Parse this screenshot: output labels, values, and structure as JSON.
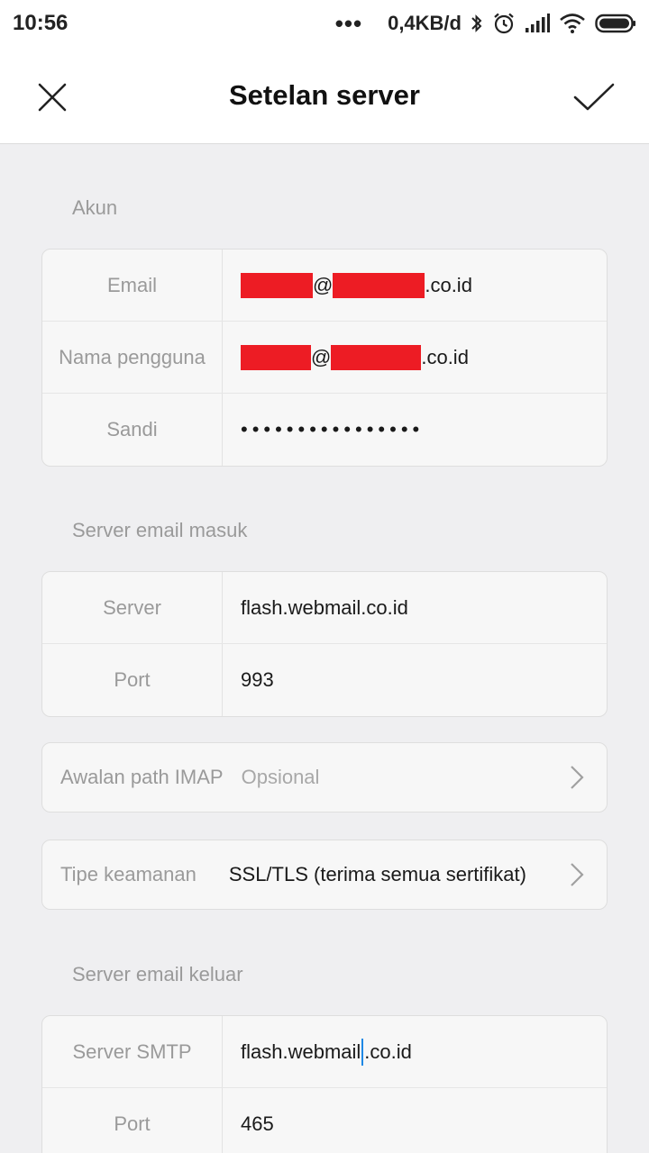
{
  "status_bar": {
    "time": "10:56",
    "dots": "•••",
    "network_speed": "0,4KB/d"
  },
  "app_bar": {
    "title": "Setelan server"
  },
  "account_section": {
    "heading": "Akun",
    "email_label": "Email",
    "email_suffix": ".co.id",
    "at_sign": "@",
    "username_label": "Nama pengguna",
    "username_suffix": ".co.id",
    "password_label": "Sandi",
    "password_mask": "••••••••••••••••"
  },
  "incoming_section": {
    "heading": "Server email masuk",
    "server_label": "Server",
    "server_value": "flash.webmail.co.id",
    "port_label": "Port",
    "port_value": "993",
    "imap_prefix_label": "Awalan path IMAP",
    "imap_prefix_placeholder": "Opsional",
    "security_label": "Tipe keamanan",
    "security_value": "SSL/TLS (terima semua sertifikat)"
  },
  "outgoing_section": {
    "heading": "Server email keluar",
    "smtp_label": "Server SMTP",
    "smtp_value_before_cursor": "flash.webmail",
    "smtp_value_after_cursor": ".co.id",
    "port_label": "Port",
    "port_value": "465"
  },
  "colors": {
    "redaction": "#ed1c24",
    "cursor": "#1e88e5"
  }
}
